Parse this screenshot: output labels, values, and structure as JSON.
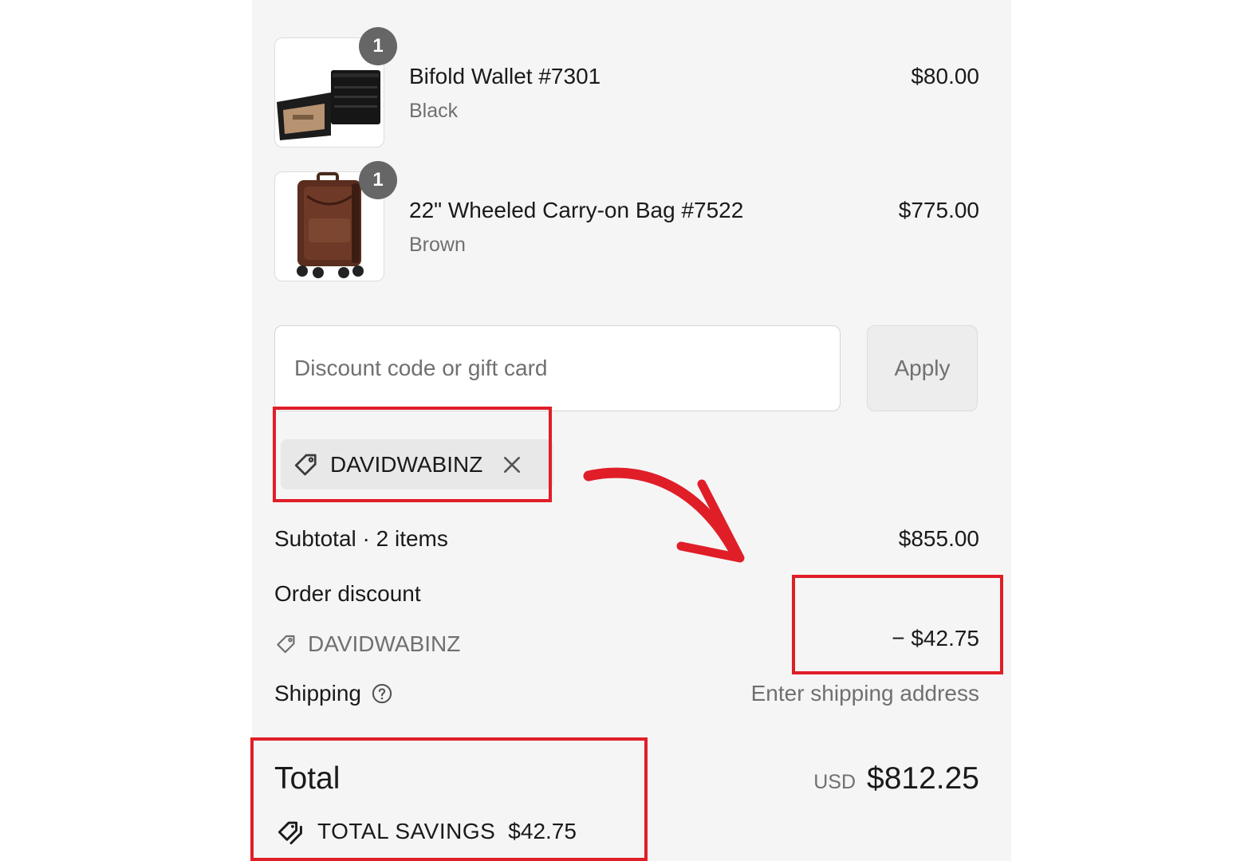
{
  "items": [
    {
      "name": "Bifold Wallet #7301",
      "variant": "Black",
      "price": "$80.00",
      "quantity": "1",
      "image": "wallet-image"
    },
    {
      "name": "22\" Wheeled Carry-on Bag #7522",
      "variant": "Brown",
      "price": "$775.00",
      "quantity": "1",
      "image": "carry-on-bag-image"
    }
  ],
  "discount": {
    "placeholder": "Discount code or gift card",
    "apply_label": "Apply",
    "applied_code": "DAVIDWABINZ"
  },
  "summary": {
    "subtotal_label": "Subtotal · 2 items",
    "subtotal_value": "$855.00",
    "order_discount_label": "Order discount",
    "order_discount_code": "DAVIDWABINZ",
    "order_discount_value": "− $42.75",
    "shipping_label": "Shipping",
    "shipping_value": "Enter shipping address",
    "total_label": "Total",
    "currency": "USD",
    "total_value": "$812.25",
    "savings_label": "TOTAL SAVINGS",
    "savings_value": "$42.75"
  },
  "colors": {
    "panel_background": "#f5f5f5",
    "annotation_red": "#e01e28",
    "muted_text": "#707070",
    "badge": "#666666"
  }
}
